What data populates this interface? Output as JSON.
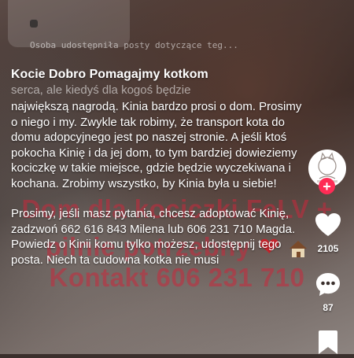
{
  "suggestion": {
    "text": "Osoba udostępniła posty dotyczące teg..."
  },
  "post": {
    "title": "Kocie Dobro Pomagajmy kotkom",
    "clipped_line": "serca, ale kiedyś dla kogoś będzie",
    "paragraph1": "największą nagrodą. Kinia bardzo prosi o dom. Prosimy o niego i my. Zwykle tak robimy, że transport kota do domu adopcyjnego jest po naszej stronie. A jeśli ktoś pokocha Kinię i da jej dom, to tym bardziej dowieziemy kociczkę w takie miejsce, gdzie będzie wyczekiwana i kochana. Zrobimy wszystko, by Kinia była u siebie!",
    "paragraph2": "Prosimy, jeśli masz pytania, chcesz adoptować Kinię, zadzwoń 662 616 843 Milena lub 606 231 710 Magda. Powiedz o Kinii komu tylko możesz, udostępnij tego posta. Niech ta cudowna kotka nie musi"
  },
  "overlay": {
    "line1": "Dom dla kociczki FeLV +",
    "line2": "pilnie potrzebny",
    "line3": "Kontakt 606 231 710"
  },
  "actions": {
    "likes": "2105",
    "comments": "87"
  },
  "colors": {
    "follow": "#fe2c55"
  }
}
